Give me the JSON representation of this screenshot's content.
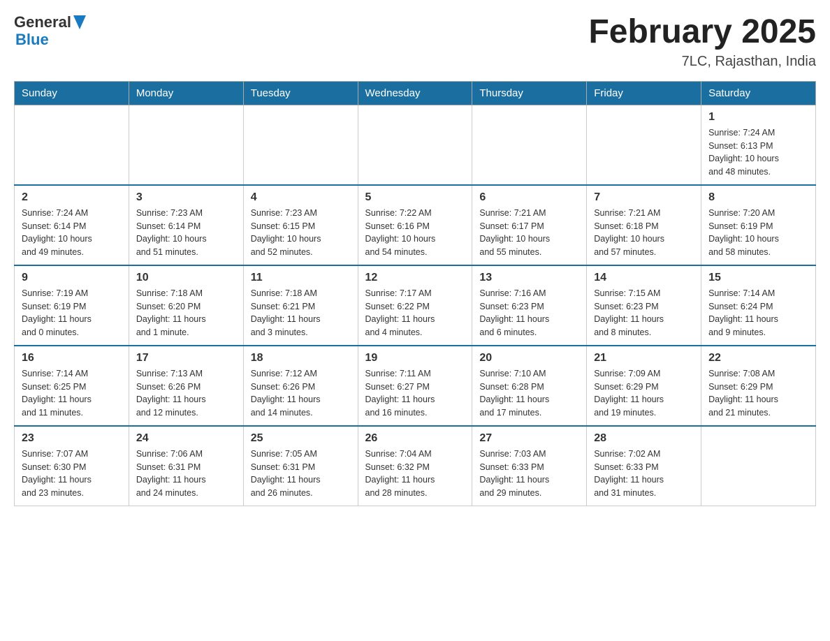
{
  "header": {
    "logo": {
      "general": "General",
      "blue": "Blue"
    },
    "title": "February 2025",
    "location": "7LC, Rajasthan, India"
  },
  "days_of_week": [
    "Sunday",
    "Monday",
    "Tuesday",
    "Wednesday",
    "Thursday",
    "Friday",
    "Saturday"
  ],
  "weeks": [
    {
      "days": [
        {
          "number": "",
          "info": ""
        },
        {
          "number": "",
          "info": ""
        },
        {
          "number": "",
          "info": ""
        },
        {
          "number": "",
          "info": ""
        },
        {
          "number": "",
          "info": ""
        },
        {
          "number": "",
          "info": ""
        },
        {
          "number": "1",
          "info": "Sunrise: 7:24 AM\nSunset: 6:13 PM\nDaylight: 10 hours\nand 48 minutes."
        }
      ]
    },
    {
      "days": [
        {
          "number": "2",
          "info": "Sunrise: 7:24 AM\nSunset: 6:14 PM\nDaylight: 10 hours\nand 49 minutes."
        },
        {
          "number": "3",
          "info": "Sunrise: 7:23 AM\nSunset: 6:14 PM\nDaylight: 10 hours\nand 51 minutes."
        },
        {
          "number": "4",
          "info": "Sunrise: 7:23 AM\nSunset: 6:15 PM\nDaylight: 10 hours\nand 52 minutes."
        },
        {
          "number": "5",
          "info": "Sunrise: 7:22 AM\nSunset: 6:16 PM\nDaylight: 10 hours\nand 54 minutes."
        },
        {
          "number": "6",
          "info": "Sunrise: 7:21 AM\nSunset: 6:17 PM\nDaylight: 10 hours\nand 55 minutes."
        },
        {
          "number": "7",
          "info": "Sunrise: 7:21 AM\nSunset: 6:18 PM\nDaylight: 10 hours\nand 57 minutes."
        },
        {
          "number": "8",
          "info": "Sunrise: 7:20 AM\nSunset: 6:19 PM\nDaylight: 10 hours\nand 58 minutes."
        }
      ]
    },
    {
      "days": [
        {
          "number": "9",
          "info": "Sunrise: 7:19 AM\nSunset: 6:19 PM\nDaylight: 11 hours\nand 0 minutes."
        },
        {
          "number": "10",
          "info": "Sunrise: 7:18 AM\nSunset: 6:20 PM\nDaylight: 11 hours\nand 1 minute."
        },
        {
          "number": "11",
          "info": "Sunrise: 7:18 AM\nSunset: 6:21 PM\nDaylight: 11 hours\nand 3 minutes."
        },
        {
          "number": "12",
          "info": "Sunrise: 7:17 AM\nSunset: 6:22 PM\nDaylight: 11 hours\nand 4 minutes."
        },
        {
          "number": "13",
          "info": "Sunrise: 7:16 AM\nSunset: 6:23 PM\nDaylight: 11 hours\nand 6 minutes."
        },
        {
          "number": "14",
          "info": "Sunrise: 7:15 AM\nSunset: 6:23 PM\nDaylight: 11 hours\nand 8 minutes."
        },
        {
          "number": "15",
          "info": "Sunrise: 7:14 AM\nSunset: 6:24 PM\nDaylight: 11 hours\nand 9 minutes."
        }
      ]
    },
    {
      "days": [
        {
          "number": "16",
          "info": "Sunrise: 7:14 AM\nSunset: 6:25 PM\nDaylight: 11 hours\nand 11 minutes."
        },
        {
          "number": "17",
          "info": "Sunrise: 7:13 AM\nSunset: 6:26 PM\nDaylight: 11 hours\nand 12 minutes."
        },
        {
          "number": "18",
          "info": "Sunrise: 7:12 AM\nSunset: 6:26 PM\nDaylight: 11 hours\nand 14 minutes."
        },
        {
          "number": "19",
          "info": "Sunrise: 7:11 AM\nSunset: 6:27 PM\nDaylight: 11 hours\nand 16 minutes."
        },
        {
          "number": "20",
          "info": "Sunrise: 7:10 AM\nSunset: 6:28 PM\nDaylight: 11 hours\nand 17 minutes."
        },
        {
          "number": "21",
          "info": "Sunrise: 7:09 AM\nSunset: 6:29 PM\nDaylight: 11 hours\nand 19 minutes."
        },
        {
          "number": "22",
          "info": "Sunrise: 7:08 AM\nSunset: 6:29 PM\nDaylight: 11 hours\nand 21 minutes."
        }
      ]
    },
    {
      "days": [
        {
          "number": "23",
          "info": "Sunrise: 7:07 AM\nSunset: 6:30 PM\nDaylight: 11 hours\nand 23 minutes."
        },
        {
          "number": "24",
          "info": "Sunrise: 7:06 AM\nSunset: 6:31 PM\nDaylight: 11 hours\nand 24 minutes."
        },
        {
          "number": "25",
          "info": "Sunrise: 7:05 AM\nSunset: 6:31 PM\nDaylight: 11 hours\nand 26 minutes."
        },
        {
          "number": "26",
          "info": "Sunrise: 7:04 AM\nSunset: 6:32 PM\nDaylight: 11 hours\nand 28 minutes."
        },
        {
          "number": "27",
          "info": "Sunrise: 7:03 AM\nSunset: 6:33 PM\nDaylight: 11 hours\nand 29 minutes."
        },
        {
          "number": "28",
          "info": "Sunrise: 7:02 AM\nSunset: 6:33 PM\nDaylight: 11 hours\nand 31 minutes."
        },
        {
          "number": "",
          "info": ""
        }
      ]
    }
  ]
}
